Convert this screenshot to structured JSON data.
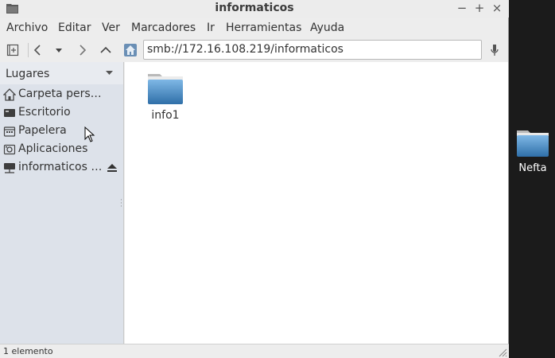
{
  "window": {
    "title": "informaticos",
    "controls": {
      "minimize": "−",
      "maximize": "+",
      "close": "×"
    }
  },
  "menubar": {
    "items": [
      "Archivo",
      "Editar",
      "Ver",
      "Marcadores",
      "Ir",
      "Herramientas",
      "Ayuda"
    ]
  },
  "toolbar": {
    "location": "smb://172.16.108.219/informaticos",
    "icons": [
      "new-tab-icon",
      "back-icon",
      "history-dropdown-icon",
      "forward-icon",
      "up-icon",
      "home-icon",
      "mic-icon"
    ]
  },
  "sidebar": {
    "header": "Lugares",
    "items": [
      {
        "label": "Carpeta pers…",
        "icon": "home-icon"
      },
      {
        "label": "Escritorio",
        "icon": "desktop-icon"
      },
      {
        "label": "Papelera",
        "icon": "trash-icon"
      },
      {
        "label": "Aplicaciones",
        "icon": "applications-icon"
      },
      {
        "label": "informaticos …",
        "icon": "network-drive-icon"
      }
    ]
  },
  "content": {
    "files": [
      {
        "name": "info1",
        "icon": "folder-icon"
      }
    ]
  },
  "statusbar": {
    "text": "1 elemento"
  },
  "desktop": {
    "icons": [
      {
        "label": "Nefta",
        "icon": "folder-icon"
      }
    ]
  },
  "colors": {
    "folder": "#4a90c8",
    "sidebar_bg": "#dde2ea",
    "desktop_bg": "#1b1b1b"
  }
}
